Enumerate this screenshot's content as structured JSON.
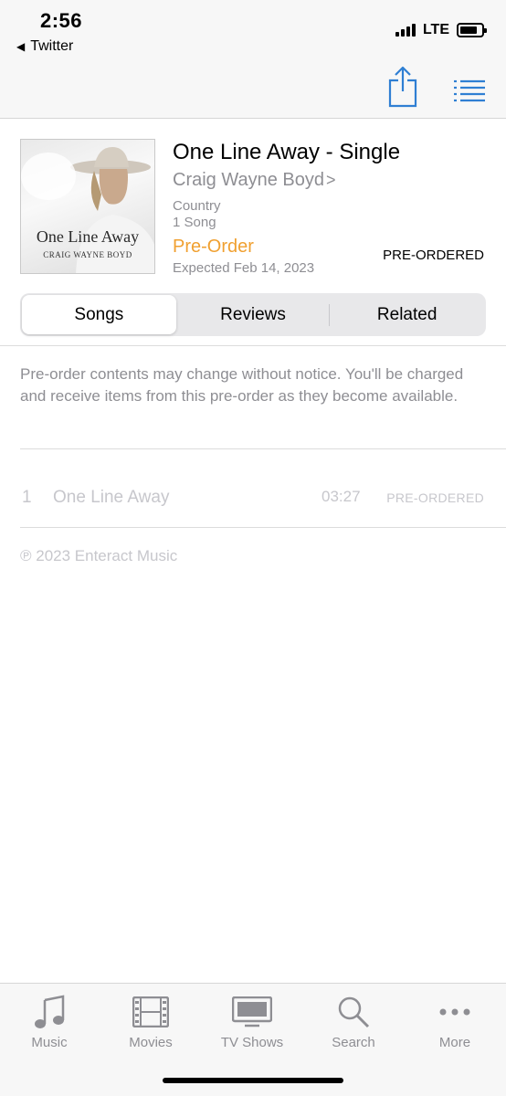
{
  "status_bar": {
    "time": "2:56",
    "back_app": "Twitter",
    "network": "LTE"
  },
  "nav": {
    "share_icon": "share-icon",
    "list_icon": "list-icon"
  },
  "album": {
    "title": "One Line Away - Single",
    "artist": "Craig Wayne Boyd",
    "artist_chevron": ">",
    "genre": "Country",
    "song_count": "1 Song",
    "preorder_label": "Pre-Order",
    "expected": "Expected Feb 14, 2023",
    "status": "PRE-ORDERED",
    "artwork_title": "One Line Away",
    "artwork_artist": "CRAIG WAYNE BOYD"
  },
  "segments": {
    "items": [
      "Songs",
      "Reviews",
      "Related"
    ],
    "selected": "Songs"
  },
  "notice": "Pre-order contents may change without notice. You'll be charged and receive items from this pre-order as they become available.",
  "tracks": [
    {
      "number": "1",
      "title": "One Line Away",
      "duration": "03:27",
      "status": "PRE-ORDERED"
    }
  ],
  "copyright": "℗ 2023 Enteract Music",
  "tab_bar": {
    "items": [
      {
        "label": "Music",
        "icon": "music-note-icon"
      },
      {
        "label": "Movies",
        "icon": "film-icon"
      },
      {
        "label": "TV Shows",
        "icon": "tv-icon"
      },
      {
        "label": "Search",
        "icon": "search-icon"
      },
      {
        "label": "More",
        "icon": "more-icon"
      }
    ]
  },
  "colors": {
    "accent_orange": "#f0a030",
    "link_blue": "#2f7fd3",
    "secondary_gray": "#8e8e93",
    "disabled_gray": "#c7c7cc"
  }
}
